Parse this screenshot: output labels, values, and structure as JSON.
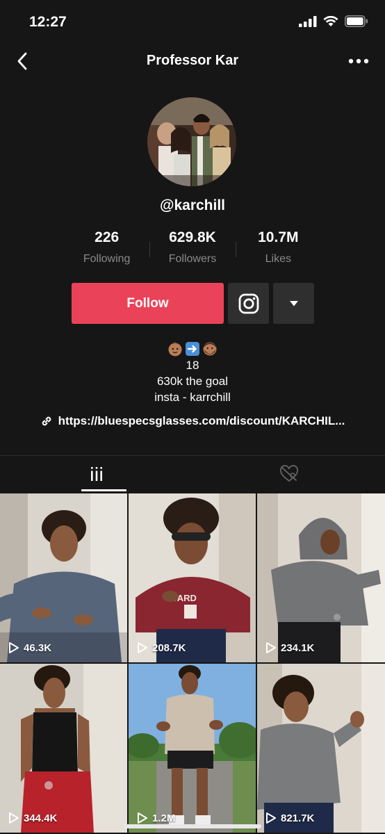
{
  "status_bar": {
    "time": "12:27"
  },
  "header": {
    "title": "Professor Kar"
  },
  "profile": {
    "handle": "@karchill",
    "stats": [
      {
        "value": "226",
        "label": "Following"
      },
      {
        "value": "629.8K",
        "label": "Followers"
      },
      {
        "value": "10.7M",
        "label": "Likes"
      }
    ]
  },
  "actions": {
    "follow_label": "Follow"
  },
  "bio": {
    "emojis": [
      "baby-face",
      "right-arrow",
      "bearded-man"
    ],
    "lines": [
      "18",
      "630k the goal",
      "insta - karrchill"
    ],
    "link": "https://bluespecsglasses.com/discount/KARCHIL..."
  },
  "tabs": [
    "videos-grid",
    "liked-videos"
  ],
  "videos": [
    {
      "views": "46.3K"
    },
    {
      "views": "208.7K"
    },
    {
      "views": "234.1K"
    },
    {
      "views": "344.4K"
    },
    {
      "views": "1.2M"
    },
    {
      "views": "821.7K"
    }
  ],
  "colors": {
    "background": "#161616",
    "follow_button": "#ea4359",
    "secondary_button": "#2f2f2f",
    "muted_text": "#8a8a8a"
  }
}
